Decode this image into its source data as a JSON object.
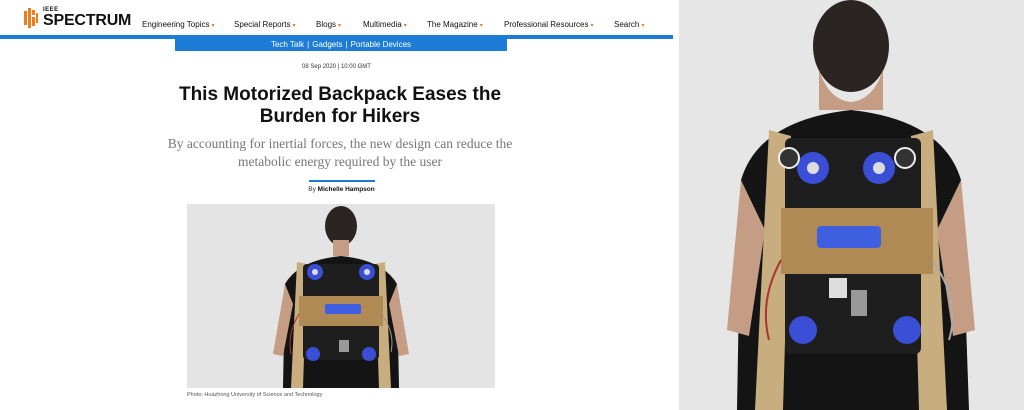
{
  "brand": {
    "small": "IEEE",
    "big": "SPECTRUM"
  },
  "nav": {
    "items": [
      {
        "label": "Engineering Topics"
      },
      {
        "label": "Special Reports"
      },
      {
        "label": "Blogs"
      },
      {
        "label": "Multimedia"
      },
      {
        "label": "The Magazine"
      },
      {
        "label": "Professional Resources"
      },
      {
        "label": "Search"
      }
    ]
  },
  "tags": [
    "Tech Talk",
    "Gadgets",
    "Portable Devices"
  ],
  "article": {
    "dateline": "08 Sep 2020 | 10:00 GMT",
    "title": "This Motorized Backpack Eases the Burden for Hikers",
    "subtitle": "By accounting for inertial forces, the new design can reduce the metabolic energy required by the user",
    "by_prefix": "By",
    "author": "Michelle Hampson",
    "photo_caption": "Photo: Huazhong University of Science and Technology"
  },
  "colors": {
    "accent": "#1d7dd6",
    "brand_orange": "#f07d1b"
  }
}
